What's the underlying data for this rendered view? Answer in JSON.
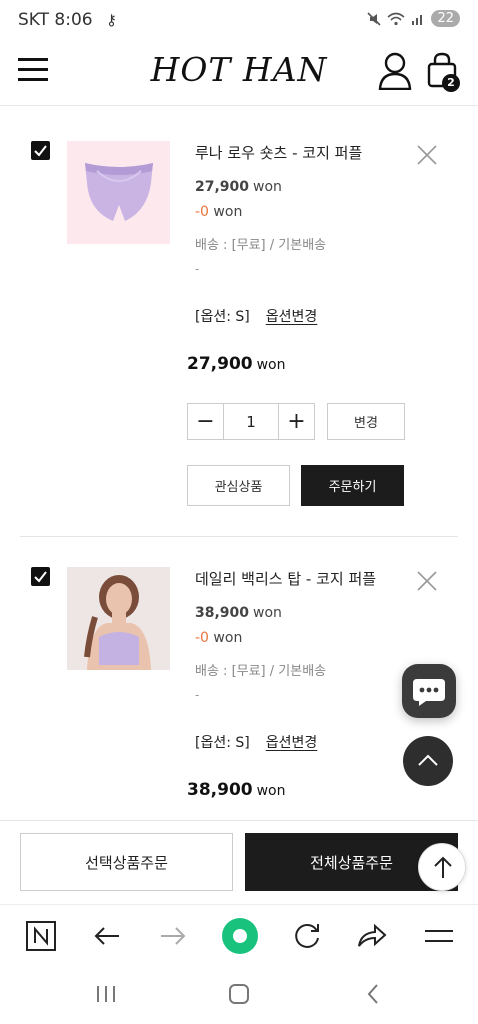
{
  "status_bar": {
    "carrier": "SKT",
    "time": "8:06",
    "battery": "22"
  },
  "header": {
    "logo": "HOT HAN",
    "cart_count": "2"
  },
  "items": [
    {
      "name": "루나 로우 숏츠 - 코지 퍼플",
      "price": "27,900",
      "discount": "-0",
      "currency": "won",
      "shipping": "배송 : [무료] / 기본배송",
      "dash": "-",
      "option": "[옵션: S]",
      "option_change": "옵션변경",
      "total": "27,900",
      "quantity": "1",
      "change_label": "변경",
      "wishlist_label": "관심상품",
      "order_label": "주문하기"
    },
    {
      "name": "데일리 백리스 탑 - 코지 퍼플",
      "price": "38,900",
      "discount": "-0",
      "currency": "won",
      "shipping": "배송 : [무료] / 기본배송",
      "dash": "-",
      "option": "[옵션: S]",
      "option_change": "옵션변경",
      "total": "38,900"
    }
  ],
  "order_bar": {
    "selected_order": "선택상품주문",
    "all_order": "전체상품주문"
  },
  "colors": {
    "accent_dark": "#1c1c1c",
    "discount": "#e8743b",
    "thumb_bg": "#fde8ee",
    "browser_green": "#19c37d"
  }
}
